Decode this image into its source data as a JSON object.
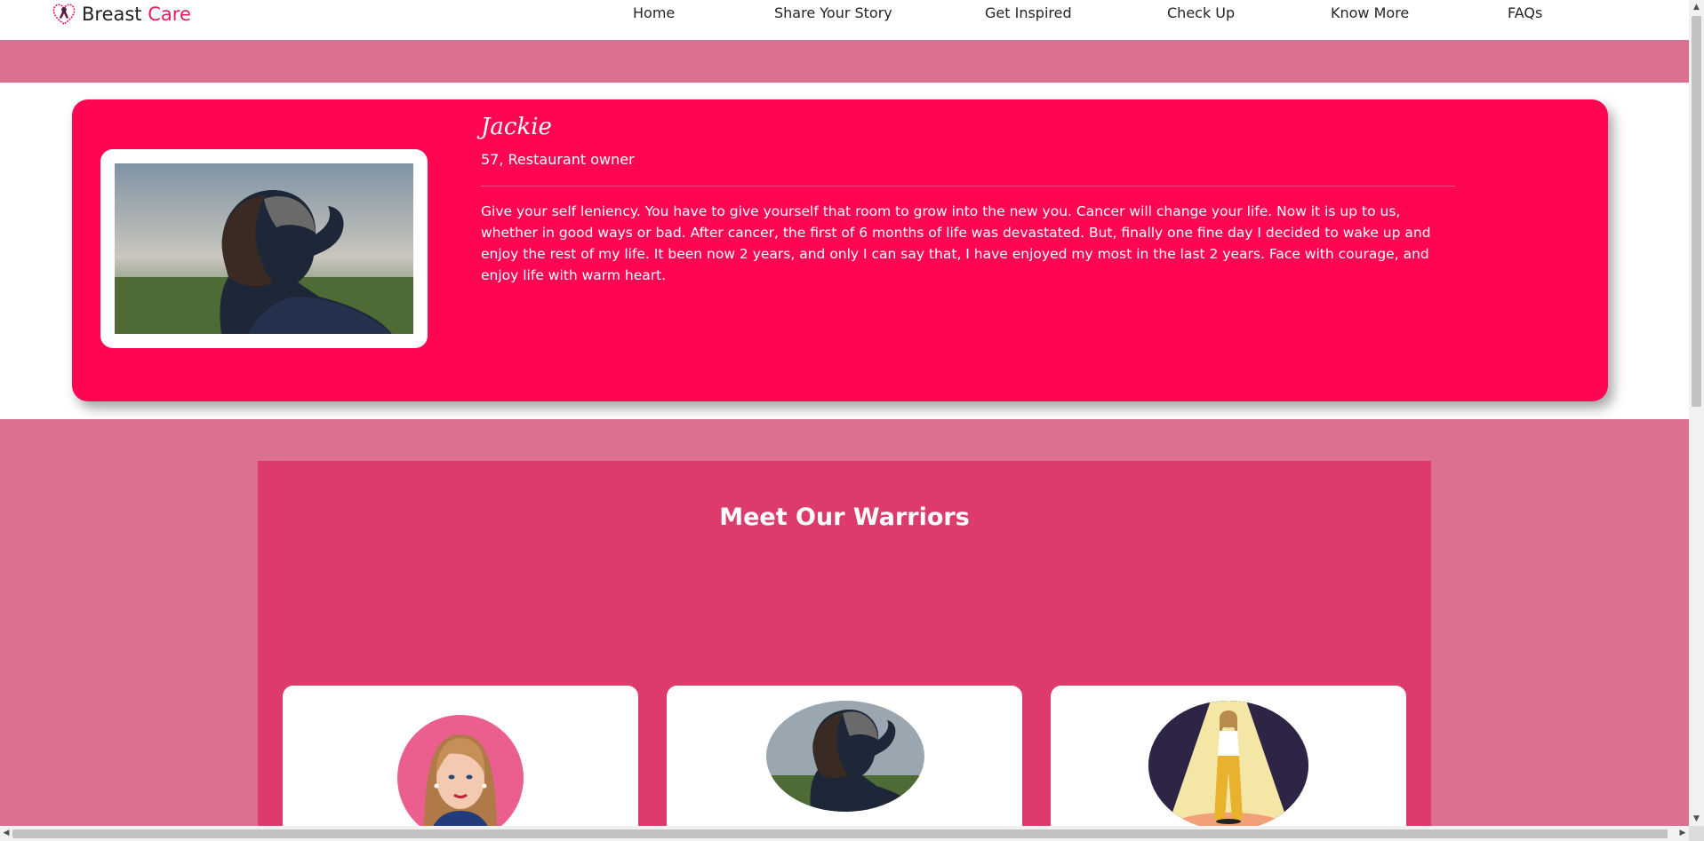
{
  "brand": {
    "name_part1": "Breast",
    "name_part2": "Care"
  },
  "nav": {
    "items": [
      {
        "label": "Home"
      },
      {
        "label": "Share Your Story"
      },
      {
        "label": "Get Inspired"
      },
      {
        "label": "Check Up"
      },
      {
        "label": "Know More"
      },
      {
        "label": "FAQs"
      }
    ]
  },
  "feature": {
    "name": "Jackie",
    "meta": "57, Restaurant owner",
    "quote": "Give your self leniency. You have to give yourself that room to grow into the new you. Cancer will change your life. Now it is up to us, whether in good ways or bad. After cancer, the first of 6 months of life was devastated. But, finally one fine day I decided to wake up and enjoy the rest of my life. It been now 2 years, and only I can say that, I have enjoyed my most in the last 2 years. Face with courage, and enjoy life with warm heart."
  },
  "warriors": {
    "title": "Meet Our Warriors"
  },
  "scrollbar": {
    "up": "▲",
    "down": "▼",
    "left": "◀",
    "right": "▶"
  },
  "colors": {
    "accent": "#e5195f",
    "feature_bg": "#ff0652",
    "band_pink": "#db708f",
    "panel_pink": "#dc3b6b"
  }
}
